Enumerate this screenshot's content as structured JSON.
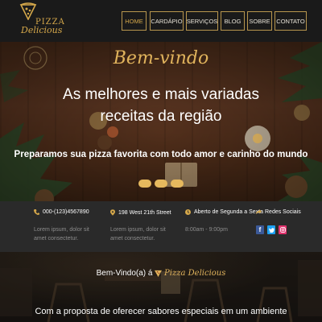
{
  "logo": {
    "line1": "PIZZA",
    "line2": "Delicious"
  },
  "nav": {
    "items": [
      {
        "label": "HOME",
        "active": true
      },
      {
        "label": "CARDÁPIO",
        "active": false
      },
      {
        "label": "SERVIÇOS",
        "active": false
      },
      {
        "label": "BLOG",
        "active": false
      },
      {
        "label": "SOBRE",
        "active": false
      },
      {
        "label": "CONTATO",
        "active": false
      }
    ]
  },
  "hero": {
    "welcome": "Bem-vindo",
    "headline": "As melhores e mais variadas receitas da região",
    "subline": "Preparamos sua pizza favorita com todo amor e carinho do mundo",
    "slides": 3
  },
  "info": {
    "phone": "000-(123)4567890",
    "phone_sub": "Lorem ipsum, dolor sit amet consectetur.",
    "address": "198 West 21th Street",
    "address_sub": "Lorem ipsum, dolor sit amet consectetur.",
    "hours": "Aberto de Segunda a Sexta",
    "hours_sub": "8:00am - 9:00pm",
    "social": "Redes Sociais"
  },
  "restaurant": {
    "welcome_prefix": "Bem-Vindo(a) á",
    "brand": "Pizza Delicious",
    "text": "Com a proposta de oferecer sabores especiais em um ambiente"
  },
  "colors": {
    "accent": "#d4a74a",
    "facebook": "#3b5998",
    "twitter": "#1da1f2",
    "instagram": "#e1306c"
  }
}
